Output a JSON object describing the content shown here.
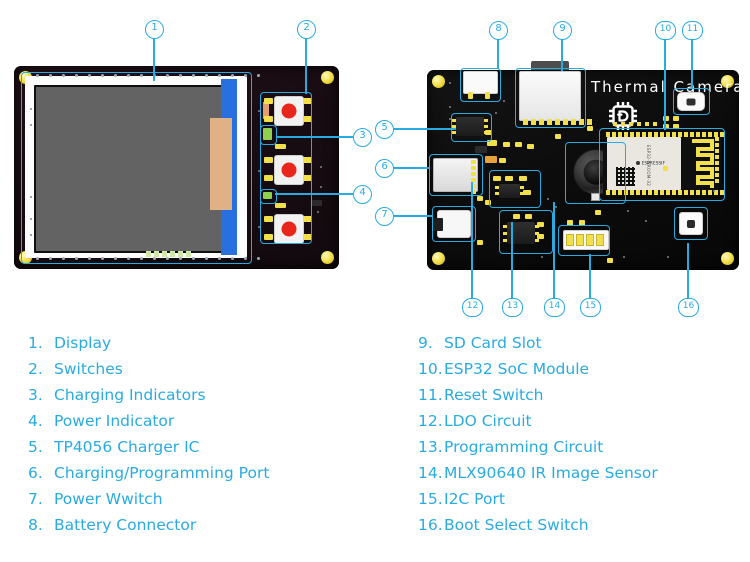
{
  "title_silkscreen": "Thermal Camera",
  "colors": {
    "callout": "#29abe2",
    "legend_text": "#29abe2",
    "pcb_front": "#1a0d12",
    "pcb_back": "#0d0d0d",
    "button_red": "#e8261c",
    "flex_blue": "#2a6fe0",
    "flex_tan": "#e0b184",
    "pad_gold": "#f1e04c",
    "mount_hole": "#f2e04a"
  },
  "module": {
    "name": "ESP32-WROOM-32",
    "vendor": "ESPRESSIF",
    "side_text": "ESP32-WROOM-32"
  },
  "callouts": [
    {
      "id": "1",
      "label": "Display"
    },
    {
      "id": "2",
      "label": "Switches"
    },
    {
      "id": "3",
      "label": "Charging Indicators"
    },
    {
      "id": "4",
      "label": "Power Indicator"
    },
    {
      "id": "5",
      "label": "TP4056 Charger IC"
    },
    {
      "id": "6",
      "label": "Charging/Programming Port"
    },
    {
      "id": "7",
      "label": "Power Wwitch"
    },
    {
      "id": "8",
      "label": "Battery Connector"
    },
    {
      "id": "9",
      "label": "SD Card Slot"
    },
    {
      "id": "10",
      "label": "ESP32 SoC Module"
    },
    {
      "id": "11",
      "label": "Reset Switch"
    },
    {
      "id": "12",
      "label": "LDO Circuit"
    },
    {
      "id": "13",
      "label": "Programming Circuit"
    },
    {
      "id": "14",
      "label": "MLX90640 IR Image Sensor"
    },
    {
      "id": "15",
      "label": "I2C Port"
    },
    {
      "id": "16",
      "label": "Boot Select Switch"
    }
  ],
  "legend": {
    "left": [
      {
        "num": "1.",
        "text": "Display"
      },
      {
        "num": "2.",
        "text": "Switches"
      },
      {
        "num": "3.",
        "text": "Charging Indicators"
      },
      {
        "num": "4.",
        "text": "Power Indicator"
      },
      {
        "num": "5.",
        "text": "TP4056 Charger IC"
      },
      {
        "num": "6.",
        "text": "Charging/Programming Port"
      },
      {
        "num": "7.",
        "text": "Power Wwitch"
      },
      {
        "num": "8.",
        "text": "Battery Connector"
      }
    ],
    "right": [
      {
        "num": "9.",
        "text": "SD Card Slot"
      },
      {
        "num": "10.",
        "text": "ESP32 SoC Module"
      },
      {
        "num": "11.",
        "text": "Reset Switch"
      },
      {
        "num": "12.",
        "text": "LDO Circuit"
      },
      {
        "num": "13.",
        "text": "Programming Circuit"
      },
      {
        "num": "14.",
        "text": "MLX90640 IR Image Sensor"
      },
      {
        "num": "15.",
        "text": "I2C Port"
      },
      {
        "num": "16.",
        "text": "Boot Select Switch"
      }
    ]
  }
}
